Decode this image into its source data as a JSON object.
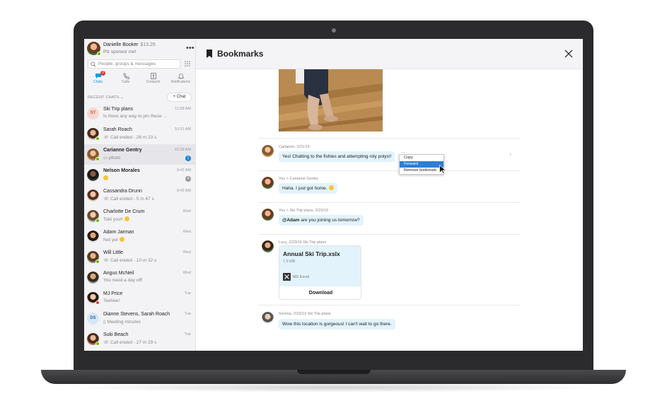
{
  "profile": {
    "name": "Danielle Booker",
    "credit": "$13.26",
    "status": "Plz sponsor me!"
  },
  "search": {
    "placeholder": "People, groups & messages"
  },
  "nav": {
    "tabs": [
      {
        "label": "Chats",
        "badge": "2"
      },
      {
        "label": "Calls"
      },
      {
        "label": "Contacts"
      },
      {
        "label": "Notifications"
      }
    ]
  },
  "recent": {
    "header": "RECENT CHATS",
    "new_chat": "+ Chat"
  },
  "chats": [
    {
      "name": "Ski Trip plans",
      "preview": "Is there any way to pin these ...",
      "time": "11:08 AM",
      "initials": "ST"
    },
    {
      "name": "Sarah Roach",
      "preview": "Call ended - 26 m 23 s",
      "time": "10:31 AM"
    },
    {
      "name": "Carianne Gentry",
      "preview": "photo",
      "time": "10:30 AM",
      "badge": "1"
    },
    {
      "name": "Nelson Morales",
      "preview": "",
      "time": "9:42 AM",
      "badge": "4"
    },
    {
      "name": "Cassandra Drunn",
      "preview": "Call ended - 5 m 47 s",
      "time": "9:42 AM"
    },
    {
      "name": "Charlotte De Crum",
      "preview": "Told you!!",
      "time": "Wed"
    },
    {
      "name": "Adam Jarman",
      "preview": "Not yet",
      "time": "Wed"
    },
    {
      "name": "Will Little",
      "preview": "Call ended - 10 m 32 s",
      "time": "Wed"
    },
    {
      "name": "Angus McNeil",
      "preview": "You need a day off!",
      "time": "Wed"
    },
    {
      "name": "MJ Price",
      "preview": "Teehee!",
      "time": "Tue"
    },
    {
      "name": "Dianne Stevens, Sarah Roach",
      "preview": "Meeting minutes",
      "time": "Tue",
      "initials": "DS"
    },
    {
      "name": "Suki Beach",
      "preview": "Call ended - 27 m 29 s",
      "time": "Tue"
    }
  ],
  "bookmarks": {
    "title": "Bookmarks",
    "messages": [
      {
        "meta": "Carianne, 2/21/19",
        "text": "Yes! Chatting to the fishies and attempting roly polys!!"
      },
      {
        "meta": "You > Carianne Gentry",
        "text": "Haha. I just got home."
      },
      {
        "meta": "You >  Ski Trip plans, 2/23/19",
        "mention": "@Adam",
        "text": " are you joining us tomorrow?"
      },
      {
        "meta": "Lucy, 2/23/19   Ski Trip plans"
      },
      {
        "meta": "Serena, 2/23/19   Ski Trip plans",
        "text": "Wow this location is gorgeous! I can't wait to go there."
      }
    ],
    "file": {
      "name": "Annual Ski Trip.xslx",
      "size": "7,6 MB",
      "type": "MS Excel",
      "action": "Download"
    },
    "context_menu": [
      "Copy",
      "Forward",
      "Remove bookmark"
    ],
    "more": "...",
    "chevron": "›"
  },
  "colors": {
    "accent": "#00a1e0",
    "bubble": "#e2f3fb",
    "highlight": "#2b7fd6"
  }
}
